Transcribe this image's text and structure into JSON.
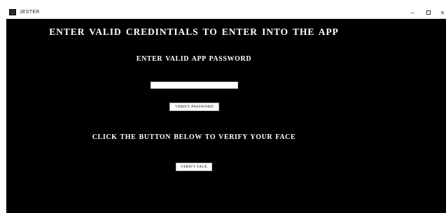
{
  "window": {
    "title": "JESTER",
    "controls": {
      "minimize": "−",
      "close": "✕"
    }
  },
  "main": {
    "heading": "ENTER VALID CREDINTIALS TO ENTER INTO THE APP",
    "password_heading": "ENTER VALID APP PASSWORD",
    "password_input": {
      "value": "",
      "placeholder": ""
    },
    "verify_password_label": "VERIFY PASSWORD",
    "face_heading": "CLICK THE BUTTON BELOW TO VERIFY YOUR FACE",
    "verify_face_label": "VERIFY FACE"
  },
  "colors": {
    "background": "#000000",
    "text": "#ffffff",
    "titlebar": "#ffffff"
  }
}
